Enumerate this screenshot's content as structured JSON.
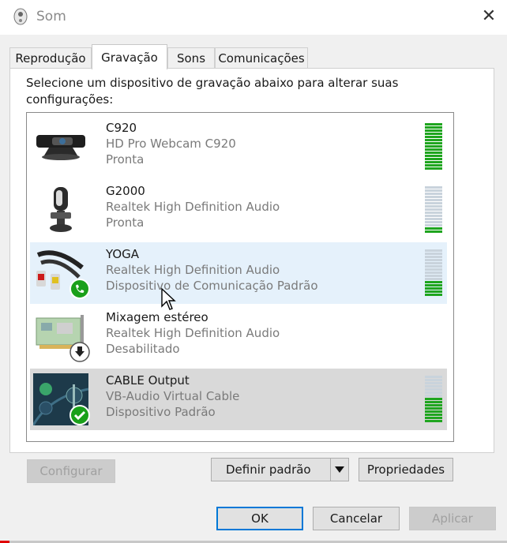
{
  "window": {
    "title": "Som",
    "close_glyph": "✕"
  },
  "tabs": [
    {
      "label": "Reprodução"
    },
    {
      "label": "Gravação"
    },
    {
      "label": "Sons"
    },
    {
      "label": "Comunicações"
    }
  ],
  "active_tab": "Gravação",
  "instructions": "Selecione um dispositivo de gravação abaixo para alterar suas configurações:",
  "devices": [
    {
      "name": "C920",
      "description": "HD Pro Webcam C920",
      "status": "Pronta",
      "icon": "webcam-icon",
      "meter_level": 1.0
    },
    {
      "name": "G2000",
      "description": "Realtek High Definition Audio",
      "status": "Pronta",
      "icon": "microphone-icon",
      "meter_level": 0.1
    },
    {
      "name": "YOGA",
      "description": "Realtek High Definition Audio",
      "status": "Dispositivo de Comunicação Padrão",
      "icon": "rca-cable-icon",
      "badge": "phone-badge-icon",
      "meter_level": 0.3
    },
    {
      "name": "Mixagem estéreo",
      "description": "Realtek High Definition Audio",
      "status": "Desabilitado",
      "icon": "sound-card-icon",
      "badge": "disabled-down-arrow-badge-icon"
    },
    {
      "name": "CABLE Output",
      "description": "VB-Audio Virtual Cable",
      "status": "Dispositivo Padrão",
      "icon": "virtual-cable-icon",
      "badge": "default-check-badge-icon",
      "meter_level": 0.55
    }
  ],
  "buttons": {
    "configure": "Configurar",
    "set_default": "Definir padrão",
    "properties": "Propriedades",
    "ok": "OK",
    "cancel": "Cancelar",
    "apply": "Aplicar"
  },
  "colors": {
    "meter_on": "#1fa51f",
    "meter_off": "#c9d3dc",
    "highlight_row": "#e5f1fb",
    "selected_row": "#d9d9d9"
  }
}
